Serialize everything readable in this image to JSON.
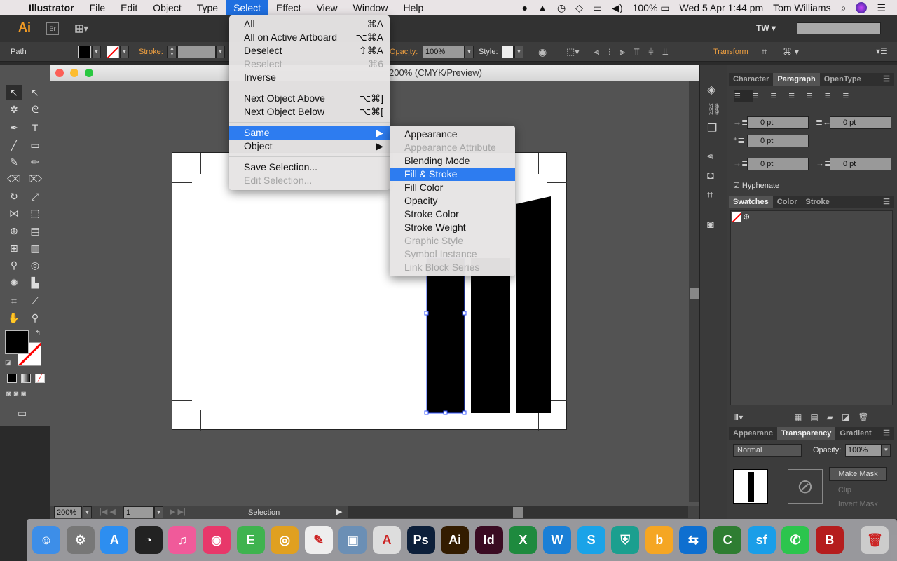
{
  "menubar": {
    "app": "Illustrator",
    "items": [
      "File",
      "Edit",
      "Object",
      "Type",
      "Select",
      "Effect",
      "View",
      "Window",
      "Help"
    ],
    "battery": "100%",
    "datetime": "Wed 5 Apr  1:44 pm",
    "user": "Tom Williams"
  },
  "appbar": {
    "logo": "Ai",
    "bridge": "Br",
    "workspace_user": "TW",
    "search_placeholder": ""
  },
  "control": {
    "selection_type": "Path",
    "stroke_label": "Stroke:",
    "stroke_value": "",
    "opacity_label": "Opacity:",
    "opacity_value": "100%",
    "style_label": "Style:",
    "transform_label": "Transform"
  },
  "document": {
    "title": "200% (CMYK/Preview)"
  },
  "status": {
    "zoom": "200%",
    "artboard": "1",
    "tool": "Selection"
  },
  "select_menu": [
    {
      "label": "All",
      "shortcut": "⌘A"
    },
    {
      "label": "All on Active Artboard",
      "shortcut": "⌥⌘A"
    },
    {
      "label": "Deselect",
      "shortcut": "⇧⌘A"
    },
    {
      "label": "Reselect",
      "shortcut": "⌘6",
      "disabled": true
    },
    {
      "label": "Inverse",
      "shortcut": ""
    },
    {
      "label": "Next Object Above",
      "shortcut": "⌥⌘]"
    },
    {
      "label": "Next Object Below",
      "shortcut": "⌥⌘["
    },
    {
      "label": "Same",
      "shortcut": "▶",
      "highlighted": true
    },
    {
      "label": "Object",
      "shortcut": "▶"
    },
    {
      "label": "Save Selection...",
      "shortcut": ""
    },
    {
      "label": "Edit Selection...",
      "shortcut": "",
      "disabled": true
    }
  ],
  "same_submenu": [
    {
      "label": "Appearance"
    },
    {
      "label": "Appearance Attribute",
      "disabled": true
    },
    {
      "label": "Blending Mode"
    },
    {
      "label": "Fill & Stroke",
      "highlighted": true
    },
    {
      "label": "Fill Color"
    },
    {
      "label": "Opacity"
    },
    {
      "label": "Stroke Color"
    },
    {
      "label": "Stroke Weight"
    },
    {
      "label": "Graphic Style",
      "disabled": true
    },
    {
      "label": "Symbol Instance",
      "disabled": true
    },
    {
      "label": "Link Block Series",
      "disabled": true
    }
  ],
  "paragraph_panel": {
    "tabs": [
      "Character",
      "Paragraph",
      "OpenType"
    ],
    "active": "Paragraph",
    "left_indent": "0 pt",
    "right_indent": "0 pt",
    "first_line_indent": "0 pt",
    "space_before": "0 pt",
    "space_after": "0 pt",
    "hyphenate_label": "Hyphenate",
    "hyphenate": true
  },
  "swatches_panel": {
    "tabs": [
      "Swatches",
      "Color",
      "Stroke"
    ],
    "active": "Swatches"
  },
  "transparency_panel": {
    "tabs": [
      "Appearanc",
      "Transparency",
      "Gradient"
    ],
    "active": "Transparency",
    "blend_mode": "Normal",
    "opacity_label": "Opacity:",
    "opacity": "100%",
    "make_mask": "Make Mask",
    "clip": "Clip",
    "invert_mask": "Invert Mask"
  },
  "dock_apps": [
    {
      "name": "finder",
      "color": "#3d8ee8",
      "glyph": "☺"
    },
    {
      "name": "system-preferences",
      "color": "#777",
      "glyph": "⚙"
    },
    {
      "name": "app-store",
      "color": "#2d8ef0",
      "glyph": "A"
    },
    {
      "name": "dashboard",
      "color": "#222",
      "glyph": "◔"
    },
    {
      "name": "itunes",
      "color": "#f05a9a",
      "glyph": "♫"
    },
    {
      "name": "kiss",
      "color": "#e8386a",
      "glyph": "◉"
    },
    {
      "name": "evernote",
      "color": "#3fb34f",
      "glyph": "E"
    },
    {
      "name": "chrome",
      "color": "#e0a020",
      "glyph": "◎"
    },
    {
      "name": "textedit",
      "color": "#eee",
      "glyph": "✎"
    },
    {
      "name": "preview",
      "color": "#6b8fb5",
      "glyph": "▣"
    },
    {
      "name": "acrobat",
      "color": "#ddd",
      "glyph": "A"
    },
    {
      "name": "photoshop",
      "color": "#0c1f3a",
      "glyph": "Ps"
    },
    {
      "name": "illustrator",
      "color": "#331c00",
      "glyph": "Ai"
    },
    {
      "name": "indesign",
      "color": "#3a0b22",
      "glyph": "Id"
    },
    {
      "name": "excel-x",
      "color": "#1e8a3e",
      "glyph": "X"
    },
    {
      "name": "word",
      "color": "#1a7fd6",
      "glyph": "W"
    },
    {
      "name": "skype",
      "color": "#1aa3e8",
      "glyph": "S"
    },
    {
      "name": "shield",
      "color": "#1b9f8f",
      "glyph": "⛨"
    },
    {
      "name": "behance",
      "color": "#f5a623",
      "glyph": "b"
    },
    {
      "name": "teamviewer",
      "color": "#0e6fd0",
      "glyph": "⇆"
    },
    {
      "name": "camtasia",
      "color": "#2e7d32",
      "glyph": "C"
    },
    {
      "name": "sf",
      "color": "#1a9ee8",
      "glyph": "sf"
    },
    {
      "name": "whatsapp",
      "color": "#2cc54d",
      "glyph": "✆"
    },
    {
      "name": "b-app",
      "color": "#b51d1d",
      "glyph": "B"
    },
    {
      "name": "trash",
      "color": "#ccc",
      "glyph": "🗑"
    }
  ]
}
